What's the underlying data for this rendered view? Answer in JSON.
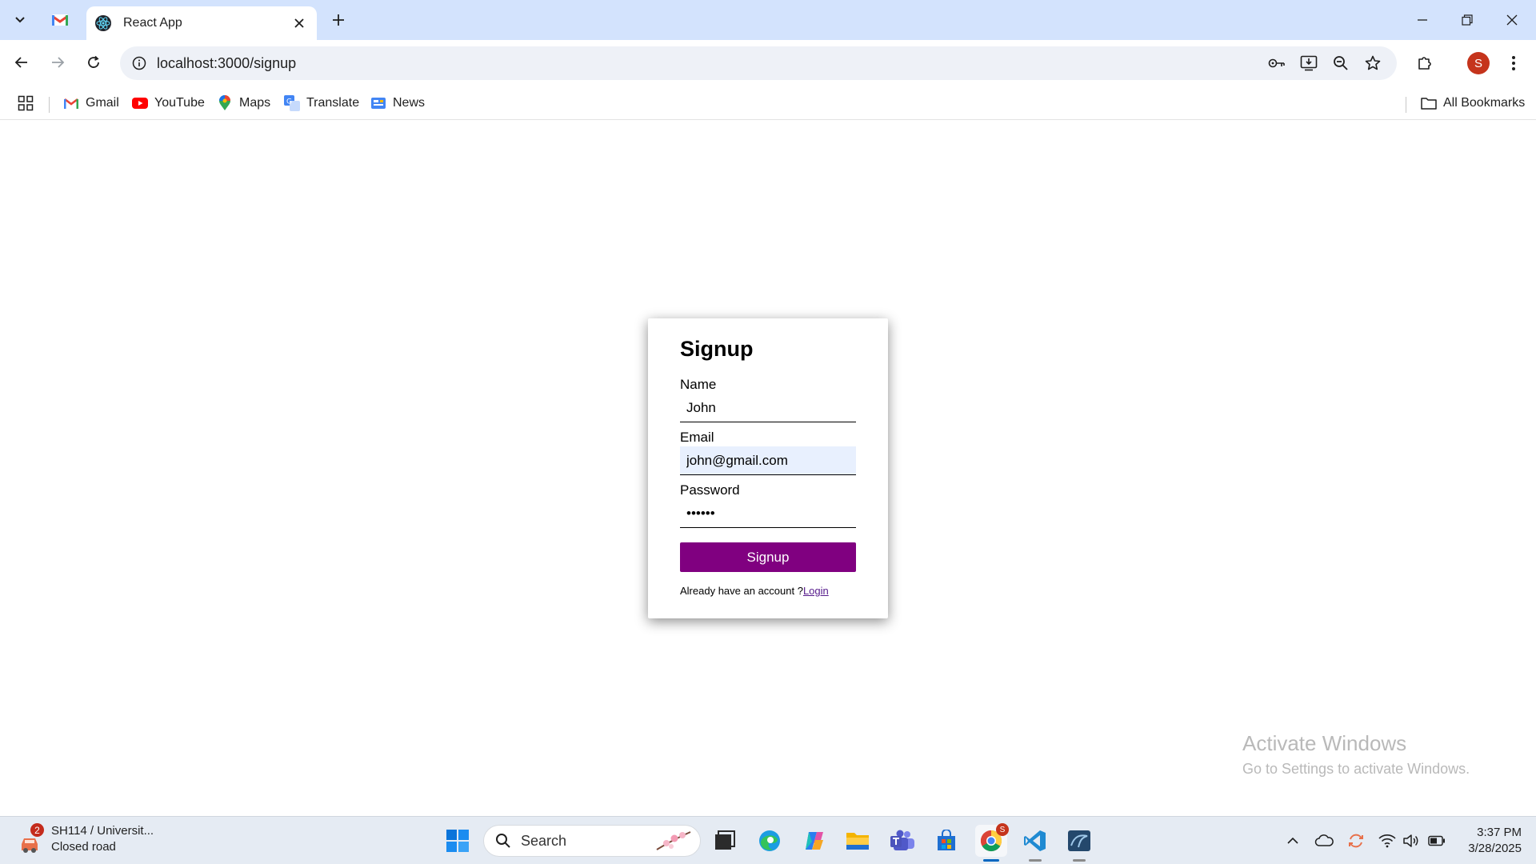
{
  "browser": {
    "active_tab_title": "React App",
    "url": "localhost:3000/signup",
    "bookmarks": [
      {
        "label": "Gmail",
        "icon": "gmail-icon"
      },
      {
        "label": "YouTube",
        "icon": "youtube-icon"
      },
      {
        "label": "Maps",
        "icon": "maps-icon"
      },
      {
        "label": "Translate",
        "icon": "translate-icon"
      },
      {
        "label": "News",
        "icon": "news-icon"
      }
    ],
    "all_bookmarks_label": "All Bookmarks",
    "profile_initial": "S"
  },
  "form": {
    "title": "Signup",
    "name_label": "Name",
    "name_value": "John",
    "email_label": "Email",
    "email_value": "john@gmail.com",
    "password_label": "Password",
    "password_value": "••••••",
    "submit_label": "Signup",
    "login_prompt": "Already have an account ?",
    "login_link": "Login",
    "accent_color": "#800080"
  },
  "watermark": {
    "line1": "Activate Windows",
    "line2": "Go to Settings to activate Windows."
  },
  "taskbar": {
    "weather_title": "SH114 / Universit...",
    "weather_subtitle": "Closed road",
    "weather_badge": "2",
    "search_label": "Search",
    "chrome_badge": "S",
    "time": "3:37 PM",
    "date": "3/28/2025"
  }
}
